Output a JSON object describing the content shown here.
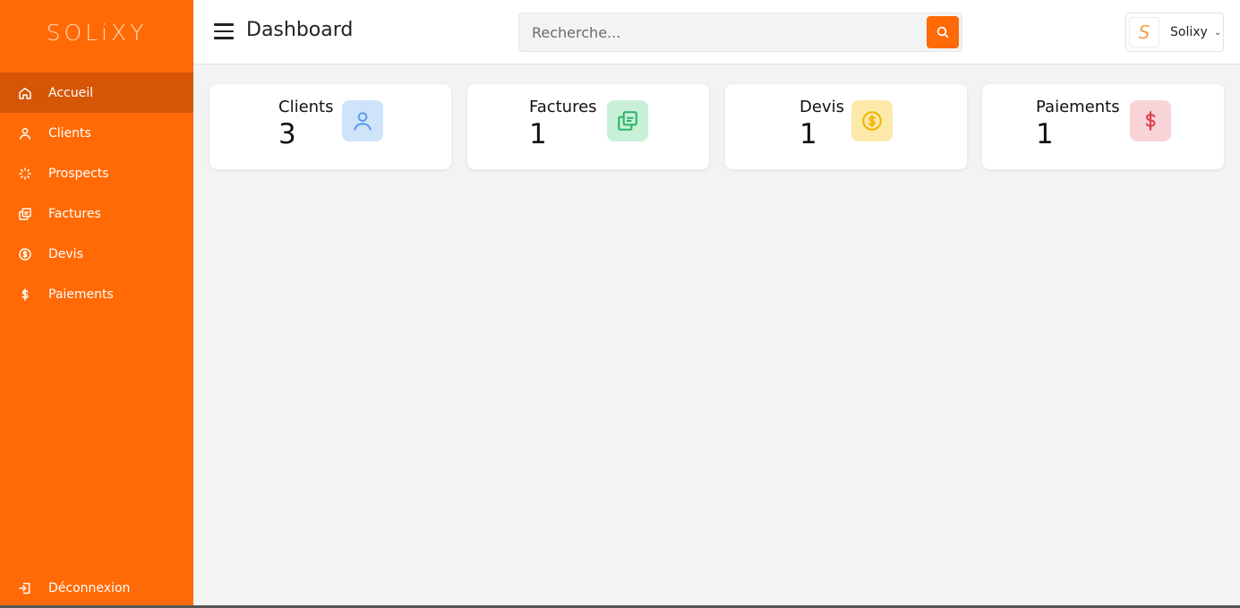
{
  "app": {
    "logo_text": "SOLiXY"
  },
  "sidebar": {
    "items": [
      {
        "label": "Accueil",
        "icon": "home-icon",
        "active": true
      },
      {
        "label": "Clients",
        "icon": "user-icon"
      },
      {
        "label": "Prospects",
        "icon": "loader-icon"
      },
      {
        "label": "Factures",
        "icon": "copy-icon"
      },
      {
        "label": "Devis",
        "icon": "coin-icon"
      },
      {
        "label": "Paiements",
        "icon": "dollar-icon"
      }
    ],
    "logout_label": "Déconnexion"
  },
  "header": {
    "title": "Dashboard",
    "search_placeholder": "Recherche...",
    "user_name": "Solixy",
    "avatar_letter": "S"
  },
  "cards": [
    {
      "label": "Clients",
      "value": "3",
      "icon": "user-icon",
      "icon_bg": "#cfe3fb",
      "icon_color": "#5a9be6"
    },
    {
      "label": "Factures",
      "value": "1",
      "icon": "copy-icon",
      "icon_bg": "#c8f0d8",
      "icon_color": "#2bb467"
    },
    {
      "label": "Devis",
      "value": "1",
      "icon": "coin-icon",
      "icon_bg": "#fde9a9",
      "icon_color": "#f0b400"
    },
    {
      "label": "Paiements",
      "value": "1",
      "icon": "dollar-icon",
      "icon_bg": "#f8d4d8",
      "icon_color": "#d9404e"
    }
  ],
  "colors": {
    "brand": "#ff6a06",
    "sidebar_active": "#d65606",
    "background": "#f3f3f3"
  }
}
